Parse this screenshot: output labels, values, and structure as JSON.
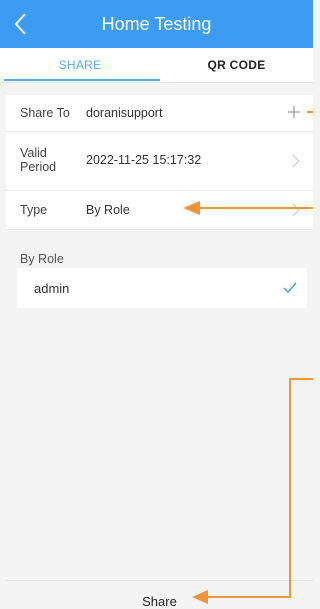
{
  "header": {
    "title": "Home Testing",
    "back_icon": "chevron-left-icon"
  },
  "tabs": [
    {
      "label": "SHARE",
      "active": true
    },
    {
      "label": "QR CODE",
      "active": false
    }
  ],
  "form": {
    "share_to": {
      "label": "Share To",
      "value": "doranisupport",
      "icon": "plus-icon"
    },
    "valid_period": {
      "label": "Valid\nPeriod",
      "value": "2022-11-25 15:17:32",
      "icon": "chevron-right-icon"
    },
    "type": {
      "label": "Type",
      "value": "By Role",
      "icon": "chevron-right-icon"
    }
  },
  "roles": {
    "section_label": "By Role",
    "items": [
      {
        "label": "admin",
        "selected": true
      }
    ]
  },
  "footer": {
    "share_label": "Share"
  },
  "colors": {
    "header_bg": "#3b9cf2",
    "accent": "#5aa9ee",
    "annotation": "#f0953a"
  }
}
